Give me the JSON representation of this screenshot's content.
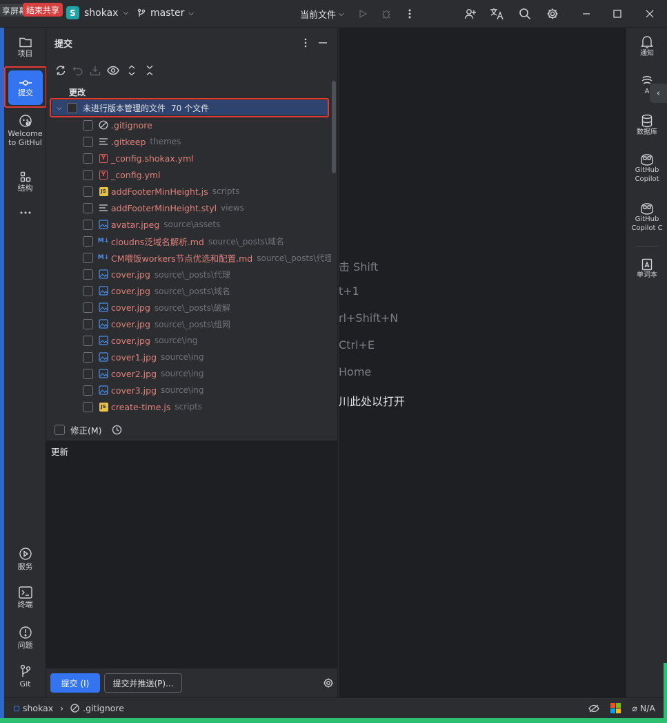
{
  "titlebar": {
    "share_left": "享屏幕",
    "share_stop": "结束共享",
    "project_badge": "S",
    "project_name": "shokax",
    "branch": "master",
    "run_config": "当前文件"
  },
  "left_tools": [
    {
      "label": "项目",
      "icon": "folder-icon"
    },
    {
      "label": "提交",
      "icon": "commit-icon"
    },
    {
      "label": "Welcome to GitHub",
      "label1": "Welcome",
      "label2": "to GitHul",
      "icon": "github-icon"
    },
    {
      "label": "结构",
      "icon": "structure-icon"
    },
    {
      "label": "服务",
      "icon": "services-icon"
    },
    {
      "label": "终端",
      "icon": "terminal-icon"
    },
    {
      "label": "问题",
      "icon": "problems-icon"
    },
    {
      "label": "Git",
      "icon": "git-icon"
    }
  ],
  "panel": {
    "title": "提交",
    "section_label": "更改",
    "group_label": "未进行版本管理的文件",
    "group_count": "70 个文件",
    "amend_label": "修正(M)",
    "commit_message": "更新",
    "commit_button": "提交 (I)",
    "commit_push_button": "提交并推送(P)..."
  },
  "files": [
    {
      "name": ".gitignore",
      "dir": "",
      "icon": "ignore"
    },
    {
      "name": ".gitkeep",
      "dir": "themes",
      "icon": "text"
    },
    {
      "name": "_config.shokax.yml",
      "dir": "",
      "icon": "yaml"
    },
    {
      "name": "_config.yml",
      "dir": "",
      "icon": "yaml"
    },
    {
      "name": "addFooterMinHeight.js",
      "dir": "scripts",
      "icon": "js"
    },
    {
      "name": "addFooterMinHeight.styl",
      "dir": "views",
      "icon": "text"
    },
    {
      "name": "avatar.jpeg",
      "dir": "source\\assets",
      "icon": "image"
    },
    {
      "name": "cloudns泛域名解析.md",
      "dir": "source\\_posts\\域名",
      "icon": "md"
    },
    {
      "name": "CM喂饭workers节点优选和配置.md",
      "dir": "source\\_posts\\代理",
      "icon": "md"
    },
    {
      "name": "cover.jpg",
      "dir": "source\\_posts\\代理",
      "icon": "image"
    },
    {
      "name": "cover.jpg",
      "dir": "source\\_posts\\域名",
      "icon": "image"
    },
    {
      "name": "cover.jpg",
      "dir": "source\\_posts\\破解",
      "icon": "image"
    },
    {
      "name": "cover.jpg",
      "dir": "source\\_posts\\组网",
      "icon": "image"
    },
    {
      "name": "cover.jpg",
      "dir": "source\\ing",
      "icon": "image"
    },
    {
      "name": "cover1.jpg",
      "dir": "source\\ing",
      "icon": "image"
    },
    {
      "name": "cover2.jpg",
      "dir": "source\\ing",
      "icon": "image"
    },
    {
      "name": "cover3.jpg",
      "dir": "source\\ing",
      "icon": "image"
    },
    {
      "name": "create-time.js",
      "dir": "scripts",
      "icon": "js"
    }
  ],
  "editor_hints": [
    "击 Shift",
    "t+1",
    "rl+Shift+N",
    "Ctrl+E",
    "Home",
    "川此处以打开"
  ],
  "right_tools": [
    {
      "label": "通知",
      "icon": "bell-icon"
    },
    {
      "label": "A",
      "icon": "ai-icon"
    },
    {
      "label": "数据库",
      "icon": "database-icon"
    },
    {
      "label1": "GitHub",
      "label2": "Copilot",
      "icon": "copilot-icon"
    },
    {
      "label1": "GitHub",
      "label2": "Copilot C",
      "icon": "copilot-chat-icon"
    },
    {
      "label": "单词本",
      "icon": "wordbook-icon"
    }
  ],
  "status": {
    "project": "shokax",
    "file": ".gitignore",
    "encoding": "N/A"
  },
  "colors": {
    "accent": "#3574f0",
    "highlight_border": "#e53935",
    "unversioned_file": "#e0807a",
    "share_stop": "#d84040"
  }
}
